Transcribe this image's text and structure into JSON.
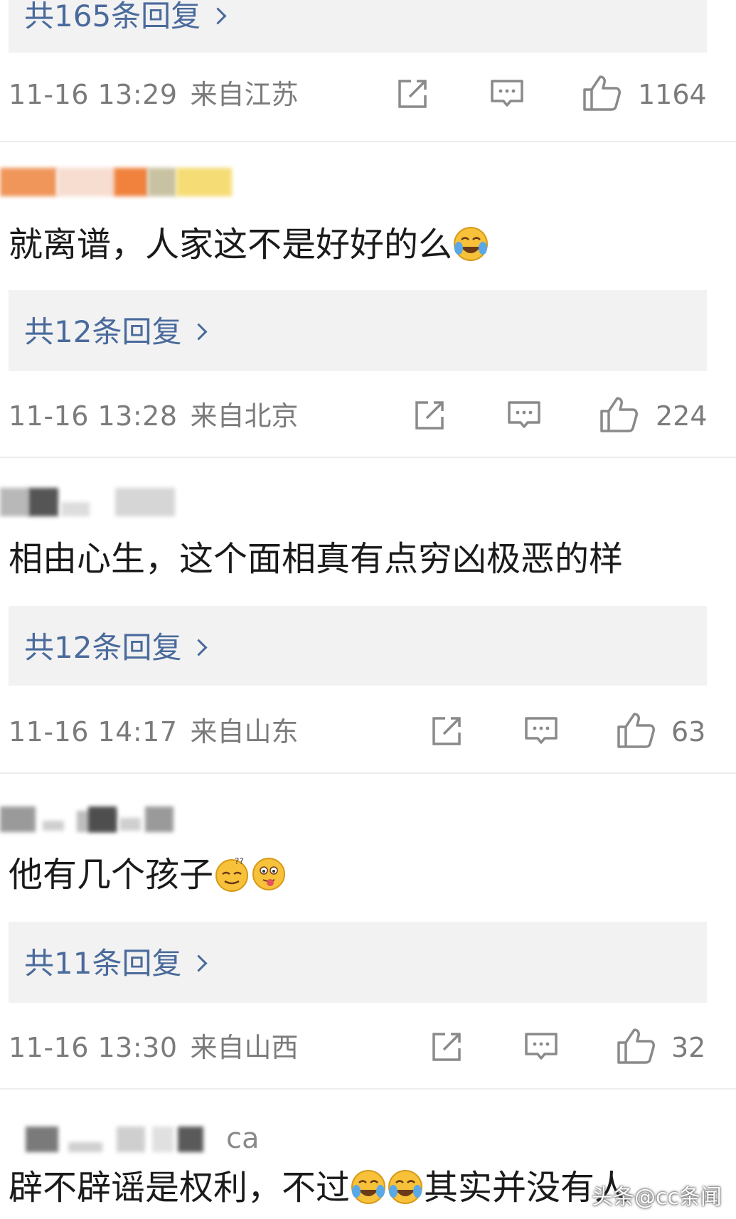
{
  "comments_top": {
    "reply_label": "共165条回复",
    "time": "11-16 13:29",
    "location": "来自江苏",
    "likes": "1164"
  },
  "comments": [
    {
      "text": "就离谱，人家这不是好好的么",
      "emojis": [
        "laugh-cry-icon"
      ],
      "reply_label": "共12条回复",
      "time": "11-16 13:28",
      "location": "来自北京",
      "likes": "224"
    },
    {
      "text": "相由心生，这个面相真有点穷凶极恶的样",
      "emojis": [],
      "reply_label": "共12条回复",
      "time": "11-16 14:17",
      "location": "来自山东",
      "likes": "63"
    },
    {
      "text": "他有几个孩子",
      "emojis": [
        "dizzy-face-icon",
        "tongue-face-icon"
      ],
      "reply_label": "共11条回复",
      "time": "11-16 13:30",
      "location": "来自山西",
      "likes": "32"
    },
    {
      "username_visible": "ca",
      "text_part1": "辟不辟谣是权利，不过",
      "text_part2": "其实并没有人",
      "emojis": [
        "laugh-cry-icon",
        "laugh-cry-icon"
      ]
    }
  ],
  "watermark": "头条@cc条闻",
  "colors": {
    "link": "#4a6a9c",
    "meta": "#7b7b7b",
    "reply_bg": "#f2f2f2",
    "text": "#1a1a1a"
  }
}
